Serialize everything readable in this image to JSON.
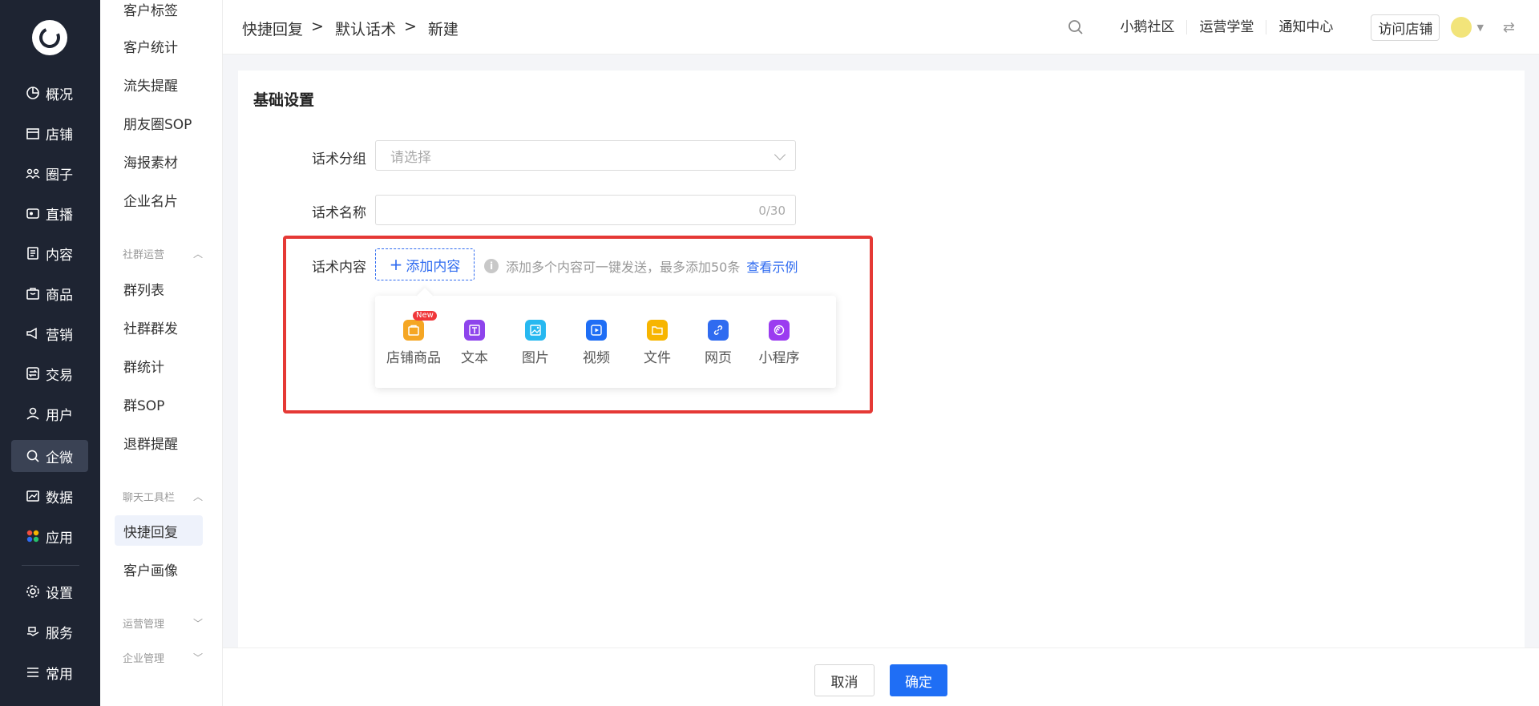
{
  "nav": {
    "items": [
      {
        "label": "概况",
        "icon": "pie-chart-icon"
      },
      {
        "label": "店铺",
        "icon": "store-icon"
      },
      {
        "label": "圈子",
        "icon": "community-icon"
      },
      {
        "label": "直播",
        "icon": "live-icon"
      },
      {
        "label": "内容",
        "icon": "document-icon"
      },
      {
        "label": "商品",
        "icon": "bag-icon"
      },
      {
        "label": "营销",
        "icon": "megaphone-icon"
      },
      {
        "label": "交易",
        "icon": "exchange-icon"
      },
      {
        "label": "用户",
        "icon": "user-icon"
      },
      {
        "label": "企微",
        "icon": "wecom-icon"
      },
      {
        "label": "数据",
        "icon": "data-icon"
      },
      {
        "label": "应用",
        "icon": "apps-icon"
      },
      {
        "label": "设置",
        "icon": "gear-icon"
      },
      {
        "label": "服务",
        "icon": "service-icon"
      },
      {
        "label": "常用",
        "icon": "list-icon"
      }
    ]
  },
  "sub": {
    "items_top": [
      "客户标签",
      "客户统计",
      "流失提醒",
      "朋友圈SOP",
      "海报素材",
      "企业名片"
    ],
    "group1": "社群运营",
    "items_group1": [
      "群列表",
      "社群群发",
      "群统计",
      "群SOP",
      "退群提醒"
    ],
    "group2": "聊天工具栏",
    "items_group2": [
      "快捷回复",
      "客户画像"
    ],
    "group3": "运营管理",
    "group4": "企业管理"
  },
  "header": {
    "crumbs": [
      "快捷回复",
      "默认话术",
      "新建"
    ],
    "sep": ">",
    "links": [
      "小鹅社区",
      "运营学堂",
      "通知中心"
    ],
    "visit": "访问店铺"
  },
  "form": {
    "title": "基础设置",
    "group_label": "话术分组",
    "group_placeholder": "请选择",
    "name_label": "话术名称",
    "name_count": "0/30",
    "content_label": "话术内容",
    "add_content": "添加内容",
    "tip": "添加多个内容可一键发送，最多添加50条",
    "example": "查看示例",
    "options": [
      {
        "label": "店铺商品",
        "color": "#f5a623",
        "badge": "New"
      },
      {
        "label": "文本",
        "color": "#8e44ec"
      },
      {
        "label": "图片",
        "color": "#27b8f0"
      },
      {
        "label": "视频",
        "color": "#1f6ef5"
      },
      {
        "label": "文件",
        "color": "#f7b500"
      },
      {
        "label": "网页",
        "color": "#2f6bf0"
      },
      {
        "label": "小程序",
        "color": "#9b3cf0"
      }
    ]
  },
  "footer": {
    "cancel": "取消",
    "ok": "确定"
  }
}
